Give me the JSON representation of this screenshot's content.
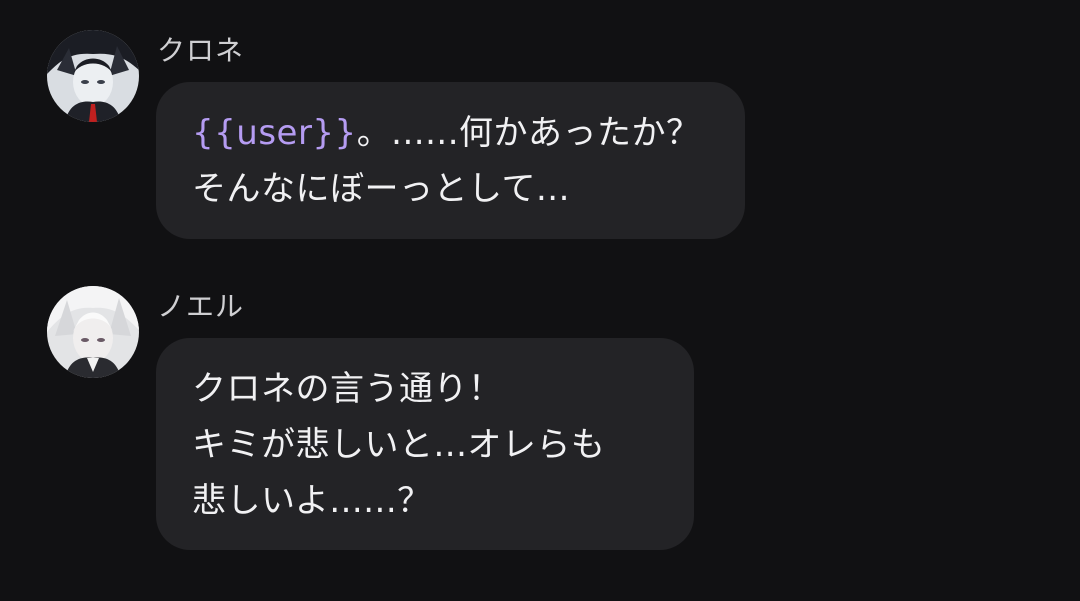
{
  "messages": [
    {
      "sender": "クロネ",
      "avatar_icon": "character-avatar-icon",
      "lines": [
        {
          "user_tag": "{{user}}",
          "text": "。......何かあったか？"
        },
        {
          "text": "そんなにぼーっとして..."
        }
      ]
    },
    {
      "sender": "ノエル",
      "avatar_icon": "character-avatar-icon",
      "lines": [
        {
          "text": "クロネの言う通り！"
        },
        {
          "text": "キミが悲しいと...オレらも"
        },
        {
          "text": "悲しいよ......？"
        }
      ]
    }
  ],
  "colors": {
    "background": "#111113",
    "bubble": "#232326",
    "text": "#f1f1f3",
    "sender_name": "#cfcfd2",
    "user_placeholder": "#b59cf2"
  }
}
